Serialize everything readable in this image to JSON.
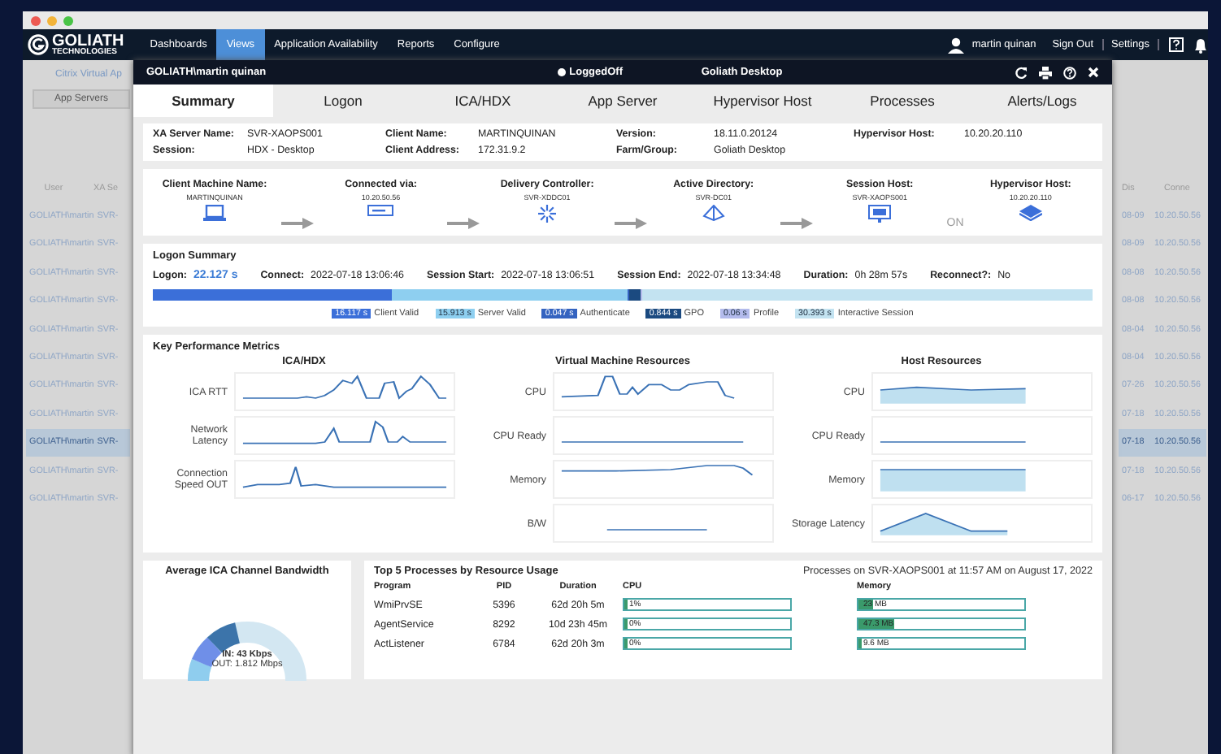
{
  "brand": {
    "name": "GOLIATH",
    "sub": "TECHNOLOGIES"
  },
  "nav": [
    {
      "label": "Dashboards",
      "selected": false
    },
    {
      "label": "Views",
      "selected": true
    },
    {
      "label": "Application Availability",
      "selected": false
    },
    {
      "label": "Reports",
      "selected": false
    },
    {
      "label": "Configure",
      "selected": false
    }
  ],
  "user": {
    "name": "martin quinan",
    "sign_out": "Sign Out",
    "settings": "Settings"
  },
  "background": {
    "breadcrumb": "Citrix Virtual Ap",
    "button": "App Servers",
    "columns": [
      "User",
      "XA Se"
    ],
    "right_columns": [
      "Dis",
      "Conne"
    ],
    "rows": [
      {
        "user": "GOLIATH\\martin",
        "server": "SVR-",
        "date": "08-09",
        "ip": "10.20.50.56",
        "selected": false
      },
      {
        "user": "GOLIATH\\martin",
        "server": "SVR-",
        "date": "08-09",
        "ip": "10.20.50.56",
        "selected": false
      },
      {
        "user": "GOLIATH\\martin",
        "server": "SVR-",
        "date": "08-08",
        "ip": "10.20.50.56",
        "selected": false
      },
      {
        "user": "GOLIATH\\martin",
        "server": "SVR-",
        "date": "08-08",
        "ip": "10.20.50.56",
        "selected": false
      },
      {
        "user": "GOLIATH\\martin",
        "server": "SVR-",
        "date": "08-04",
        "ip": "10.20.50.56",
        "selected": false
      },
      {
        "user": "GOLIATH\\martin",
        "server": "SVR-",
        "date": "08-04",
        "ip": "10.20.50.56",
        "selected": false
      },
      {
        "user": "GOLIATH\\martin",
        "server": "SVR-",
        "date": "07-26",
        "ip": "10.20.50.56",
        "selected": false
      },
      {
        "user": "GOLIATH\\martin",
        "server": "SVR-",
        "date": "07-18",
        "ip": "10.20.50.56",
        "selected": false
      },
      {
        "user": "GOLIATH\\martin",
        "server": "SVR-",
        "date": "07-18",
        "ip": "10.20.50.56",
        "selected": true
      },
      {
        "user": "GOLIATH\\martin",
        "server": "SVR-",
        "date": "07-18",
        "ip": "10.20.50.56",
        "selected": false
      },
      {
        "user": "GOLIATH\\martin",
        "server": "SVR-",
        "date": "06-17",
        "ip": "10.20.50.56",
        "selected": false
      }
    ]
  },
  "modal": {
    "user": "GOLIATH\\martin quinan",
    "status": "LoggedOff",
    "title": "Goliath Desktop",
    "tabs": [
      {
        "label": "Summary",
        "selected": true
      },
      {
        "label": "Logon",
        "selected": false
      },
      {
        "label": "ICA/HDX",
        "selected": false
      },
      {
        "label": "App Server",
        "selected": false
      },
      {
        "label": "Hypervisor Host",
        "selected": false
      },
      {
        "label": "Processes",
        "selected": false
      },
      {
        "label": "Alerts/Logs",
        "selected": false
      }
    ],
    "info": [
      [
        {
          "label": "XA Server Name:",
          "value": "SVR-XAOPS001"
        },
        {
          "label": "Client Name:",
          "value": "MARTINQUINAN"
        },
        {
          "label": "Version:",
          "value": "18.11.0.20124"
        },
        {
          "label": "Hypervisor Host:",
          "value": "10.20.20.110"
        }
      ],
      [
        {
          "label": "Session:",
          "value": "HDX - Desktop"
        },
        {
          "label": "Client Address:",
          "value": "172.31.9.2"
        },
        {
          "label": "Farm/Group:",
          "value": "Goliath Desktop"
        }
      ]
    ],
    "path": [
      {
        "kind": "node",
        "label": "Client Machine Name:",
        "value": "MARTINQUINAN"
      },
      {
        "kind": "arrow"
      },
      {
        "kind": "node",
        "label": "Connected via:",
        "value": "10.20.50.56"
      },
      {
        "kind": "arrow"
      },
      {
        "kind": "node",
        "label": "Delivery Controller:",
        "value": "SVR-XDDC01"
      },
      {
        "kind": "arrow"
      },
      {
        "kind": "node",
        "label": "Active Directory:",
        "value": "SVR-DC01"
      },
      {
        "kind": "arrow"
      },
      {
        "kind": "node",
        "label": "Session Host:",
        "value": "SVR-XAOPS001"
      },
      {
        "kind": "text",
        "text": "ON"
      },
      {
        "kind": "node",
        "label": "Hypervisor Host:",
        "value": "10.20.20.110"
      }
    ],
    "logon": {
      "title": "Logon Summary",
      "stats": [
        {
          "label": "Logon:",
          "value": "22.127 s",
          "highlight": true
        },
        {
          "label": "Connect:",
          "value": "2022-07-18 13:06:46",
          "highlight": false
        },
        {
          "label": "Session Start:",
          "value": "2022-07-18 13:06:51",
          "highlight": false
        },
        {
          "label": "Session End:",
          "value": "2022-07-18 13:34:48",
          "highlight": false
        },
        {
          "label": "Duration:",
          "value": "0h 28m 57s",
          "highlight": false
        },
        {
          "label": "Reconnect?:",
          "value": "No",
          "highlight": false
        }
      ],
      "phases": [
        {
          "value": "16.117 s",
          "label": "Client Valid",
          "color": "#3b6fd9"
        },
        {
          "value": "15.913 s",
          "label": "Server Valid",
          "color": "#8ecff0"
        },
        {
          "value": "0.047 s",
          "label": "Authenticate",
          "color": "#3463c0"
        },
        {
          "value": "0.844 s",
          "label": "GPO",
          "color": "#1b4a80"
        },
        {
          "value": "0.06 s",
          "label": "Profile",
          "color": "#b3bbec"
        },
        {
          "value": "30.393 s",
          "label": "Interactive Session",
          "color": "#c3e3f1"
        }
      ]
    },
    "kpm": {
      "title": "Key Performance Metrics",
      "groups": [
        {
          "title": "ICA/HDX",
          "rows": [
            {
              "label": "ICA RTT",
              "kind": "line"
            },
            {
              "label": "Network Latency",
              "kind": "line"
            },
            {
              "label": "Connection Speed OUT",
              "kind": "line"
            }
          ]
        },
        {
          "title": "Virtual Machine Resources",
          "rows": [
            {
              "label": "CPU",
              "kind": "line"
            },
            {
              "label": "CPU Ready",
              "kind": "line"
            },
            {
              "label": "Memory",
              "kind": "line"
            },
            {
              "label": "B/W",
              "kind": "line"
            }
          ]
        },
        {
          "title": "Host Resources",
          "rows": [
            {
              "label": "CPU",
              "kind": "area"
            },
            {
              "label": "CPU Ready",
              "kind": "line"
            },
            {
              "label": "Memory",
              "kind": "area"
            },
            {
              "label": "Storage Latency",
              "kind": "area"
            }
          ]
        }
      ]
    },
    "bandwidth": {
      "title": "Average ICA Channel Bandwidth",
      "in": "IN: 43 Kbps",
      "out": "OUT: 1.812 Mbps"
    },
    "processes": {
      "title": "Top 5 Processes by Resource Usage",
      "subtitle": "Processes on SVR-XAOPS001 at 11:57 AM on August 17, 2022",
      "columns": [
        "Program",
        "PID",
        "Duration",
        "CPU",
        "Memory"
      ],
      "rows": [
        {
          "program": "WmiPrvSE",
          "pid": "5396",
          "duration": "62d 20h 5m",
          "cpu": {
            "text": "1%",
            "level": 0.01
          },
          "memory": {
            "text": "23 MB",
            "level": 0.09
          }
        },
        {
          "program": "AgentService",
          "pid": "8292",
          "duration": "10d 23h 45m",
          "cpu": {
            "text": "0%",
            "level": 0
          },
          "memory": {
            "text": "47.3 MB",
            "level": 0.22
          }
        },
        {
          "program": "ActListener",
          "pid": "6784",
          "duration": "62d 20h 3m",
          "cpu": {
            "text": "0%",
            "level": 0
          },
          "memory": {
            "text": "9.6 MB",
            "level": 0.02
          }
        }
      ]
    }
  }
}
